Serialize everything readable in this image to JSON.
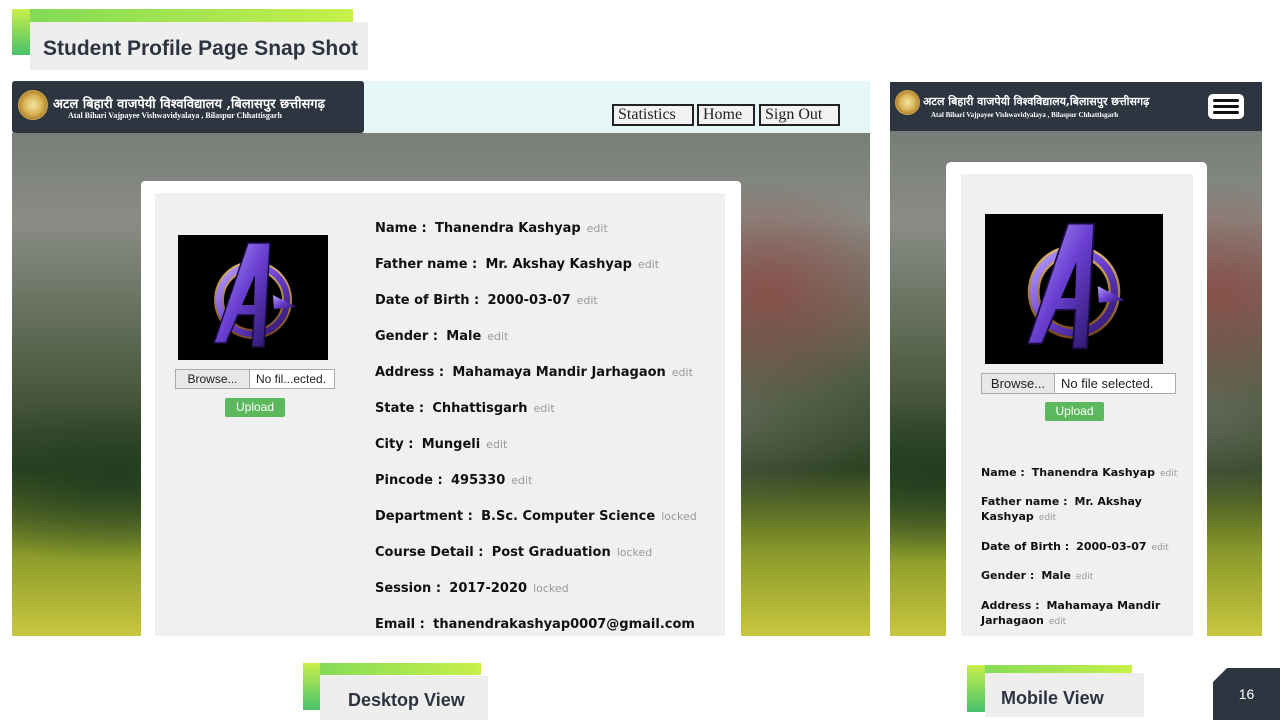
{
  "slide": {
    "title": "Student Profile Page Snap Shot",
    "desktop_label": "Desktop View",
    "mobile_label": "Mobile View",
    "page_number": "16",
    "accent_colors": [
      "#7ed957",
      "#c7f04a",
      "#2d3540"
    ]
  },
  "header": {
    "university_hindi": "अटल बिहारी वाजपेयी विश्वविद्यालय ,बिलासपुर छत्तीसगढ़",
    "university_english": "Atal Bihari Vajpayee Vishwavidyalaya , Bilaspur Chhattisgarh",
    "university_hindi_mobile": "अटल बिहारी वाजपेयी विश्वविद्यालय,बिलासपुर छत्तीसगढ़",
    "university_english_mobile": "Atal Bihari Vajpayee Vishwavidyalaya , Bilaspur Chhattisgarh",
    "nav": [
      "Statistics",
      "Home",
      "Sign Out"
    ]
  },
  "profile": {
    "browse_label": "Browse...",
    "file_name_desktop": "No fil...ected.",
    "file_name_mobile": "No file selected.",
    "upload_label": "Upload",
    "fields": [
      {
        "label": "Name :",
        "value": "Thanendra Kashyap",
        "action": "edit"
      },
      {
        "label": "Father name :",
        "value": "Mr. Akshay Kashyap",
        "action": "edit"
      },
      {
        "label": "Date of Birth :",
        "value": "2000-03-07",
        "action": "edit"
      },
      {
        "label": "Gender :",
        "value": "Male",
        "action": "edit"
      },
      {
        "label": "Address :",
        "value": "Mahamaya Mandir Jarhagaon",
        "action": "edit"
      },
      {
        "label": "State :",
        "value": "Chhattisgarh",
        "action": "edit"
      },
      {
        "label": "City :",
        "value": "Mungeli",
        "action": "edit"
      },
      {
        "label": "Pincode :",
        "value": "495330",
        "action": "edit"
      },
      {
        "label": "Department :",
        "value": "B.Sc. Computer Science",
        "action": "locked"
      },
      {
        "label": "Course Detail :",
        "value": "Post Graduation",
        "action": "locked"
      },
      {
        "label": "Session :",
        "value": "2017-2020",
        "action": "locked"
      },
      {
        "label": "Email :",
        "value": "thanendrakashyap0007@gmail.com",
        "action": ""
      }
    ]
  }
}
